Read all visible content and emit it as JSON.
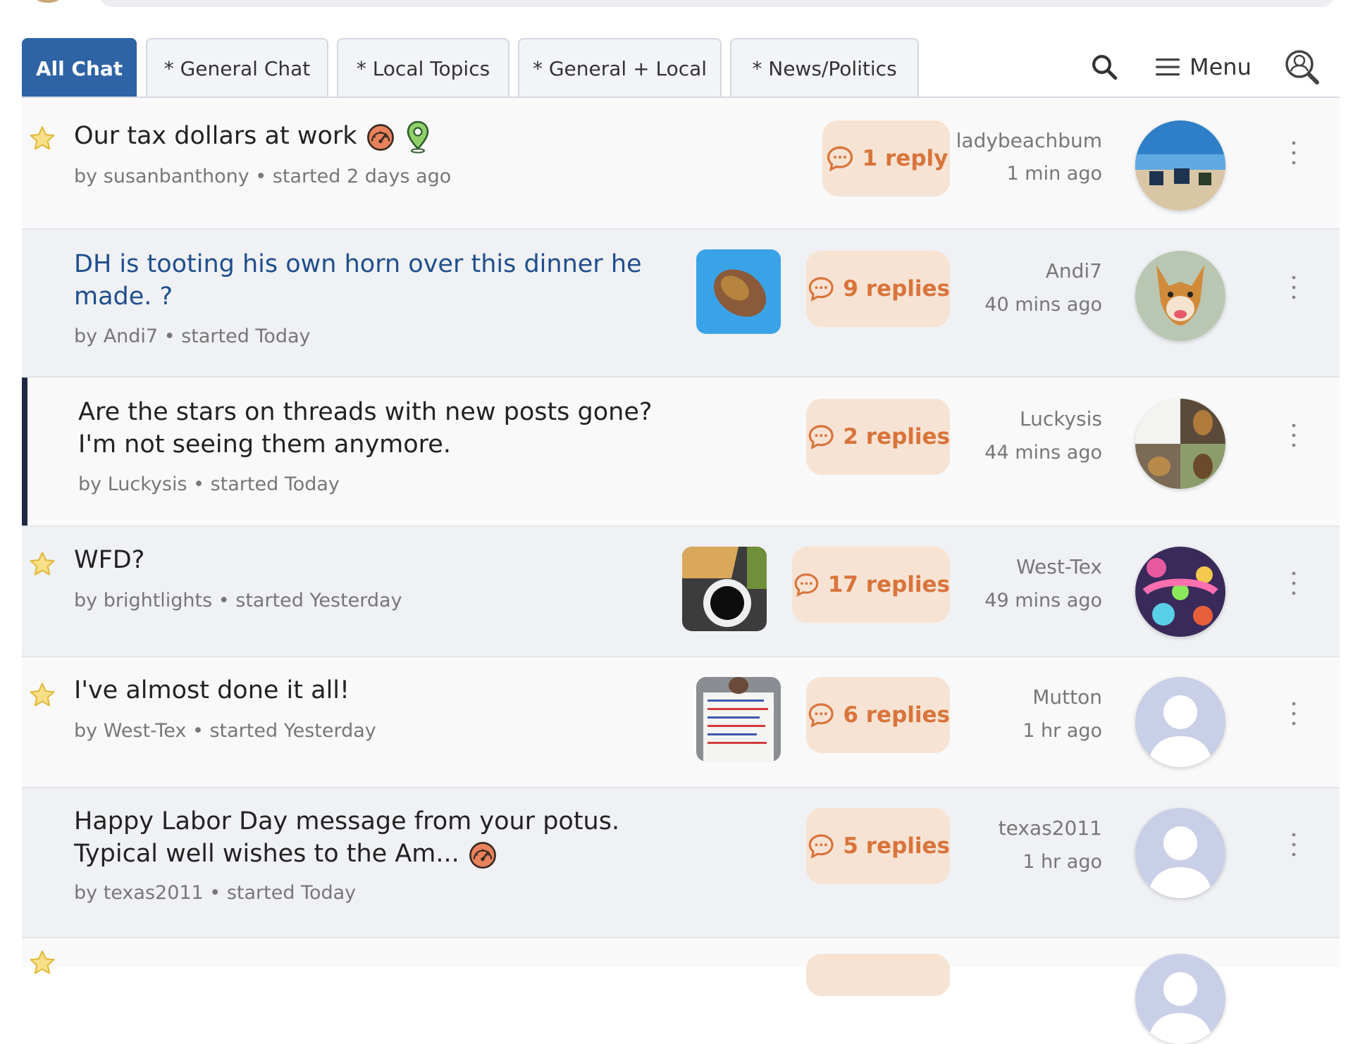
{
  "tabs": [
    {
      "label": "All Chat",
      "active": true
    },
    {
      "label": "* General Chat",
      "active": false
    },
    {
      "label": "* Local Topics",
      "active": false
    },
    {
      "label": "* General + Local",
      "active": false
    },
    {
      "label": "* News/Politics",
      "active": false
    }
  ],
  "toolbar": {
    "menu_label": "Menu"
  },
  "threads": [
    {
      "title": "Our tax dollars at work",
      "meta": "by susanbanthony • started 2 days ago",
      "replies": "1 reply",
      "last_user": "ladybeachbum",
      "last_time": "1 min ago",
      "starred": true,
      "icons": [
        "speedometer-icon",
        "location-pin-icon"
      ]
    },
    {
      "title": "DH is tooting his own horn over this dinner he made. ?",
      "meta": "by Andi7 • started Today",
      "replies": "9 replies",
      "last_user": "Andi7",
      "last_time": "40 mins ago",
      "starred": false,
      "link": true
    },
    {
      "title": "Are the stars on threads with new posts gone? I'm not seeing them anymore.",
      "meta": "by Luckysis • started Today",
      "replies": "2 replies",
      "last_user": "Luckysis",
      "last_time": "44 mins ago",
      "starred": false
    },
    {
      "title": "WFD?",
      "meta": "by brightlights • started Yesterday",
      "replies": "17 replies",
      "last_user": "West-Tex",
      "last_time": "49 mins ago",
      "starred": true
    },
    {
      "title": "I've almost done it all!",
      "meta": "by West-Tex • started Yesterday",
      "replies": "6 replies",
      "last_user": "Mutton",
      "last_time": "1 hr ago",
      "starred": true
    },
    {
      "title": "Happy Labor Day message from your potus. Typical well wishes to the Am...",
      "meta": "by texas2011 • started Today",
      "replies": "5 replies",
      "last_user": "texas2011",
      "last_time": "1 hr ago",
      "starred": false,
      "icons": [
        "speedometer-icon"
      ]
    }
  ],
  "colors": {
    "accent": "#2e63a6",
    "reply_pill": "#f7e3d3",
    "reply_text": "#d8743b",
    "star": "#f2c94c",
    "link": "#1f4e8c"
  }
}
